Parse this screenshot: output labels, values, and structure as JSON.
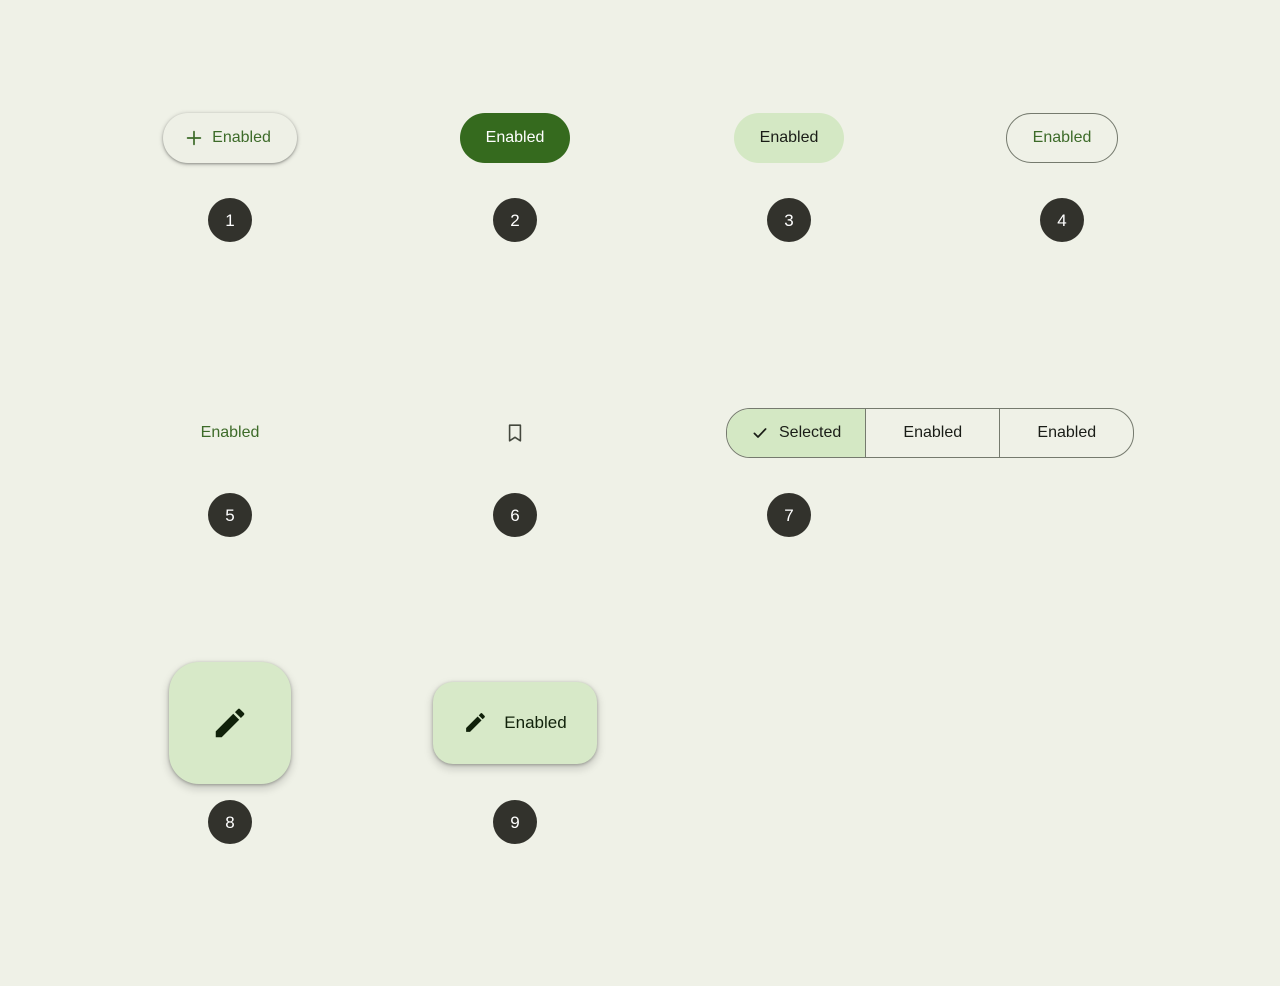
{
  "page": {
    "background_color": "#eff1e7",
    "title": "Material Buttons Specimen"
  },
  "palette": {
    "surface": "#eff1e7",
    "elevated_surface": "#eef0e6",
    "primary": "#356a1e",
    "primary_text": "#3d6b29",
    "on_primary": "#ffffff",
    "tonal_container": "#d4e8c4",
    "fab_container": "#d7e9c8",
    "on_container": "#1a1d17",
    "outline": "#757a6e",
    "badge_background": "#32322c",
    "badge_text": "#ffffff",
    "icon_color": "#44483e"
  },
  "items": [
    {
      "number": "1",
      "variant": "elevated-button",
      "label": "Enabled",
      "icon": "plus-icon",
      "has_icon": true
    },
    {
      "number": "2",
      "variant": "filled-button",
      "label": "Enabled",
      "icon": null,
      "has_icon": false
    },
    {
      "number": "3",
      "variant": "filled-tonal-button",
      "label": "Enabled",
      "icon": null,
      "has_icon": false
    },
    {
      "number": "4",
      "variant": "outlined-button",
      "label": "Enabled",
      "icon": null,
      "has_icon": false
    },
    {
      "number": "5",
      "variant": "text-button",
      "label": "Enabled",
      "icon": null,
      "has_icon": false
    },
    {
      "number": "6",
      "variant": "icon-button",
      "label": "",
      "icon": "bookmark-icon",
      "has_icon": true
    },
    {
      "number": "7",
      "variant": "segmented-button-group",
      "label": "",
      "icon": null,
      "has_icon": false
    },
    {
      "number": "8",
      "variant": "fab",
      "label": "",
      "icon": "edit-pencil-icon",
      "has_icon": true
    },
    {
      "number": "9",
      "variant": "extended-fab",
      "label": "Enabled",
      "icon": "edit-pencil-icon",
      "has_icon": true
    }
  ],
  "segmented_group": {
    "segments": [
      {
        "label": "Selected",
        "selected": true,
        "icon": "check-icon"
      },
      {
        "label": "Enabled",
        "selected": false,
        "icon": null
      },
      {
        "label": "Enabled",
        "selected": false,
        "icon": null
      }
    ]
  }
}
